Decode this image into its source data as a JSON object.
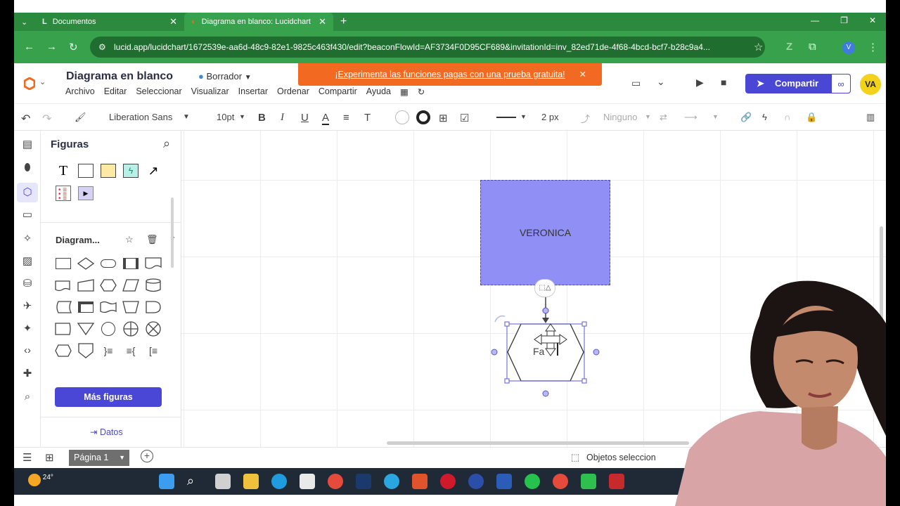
{
  "browser": {
    "tabs": [
      {
        "title": "Documentos",
        "active": false
      },
      {
        "title": "Diagrama en blanco: Lucidchart",
        "active": true
      }
    ],
    "url": "lucid.app/lucidchart/1672539e-aa6d-48c9-82e1-9825c463f430/edit?beaconFlowId=AF3734F0D95CF689&invitationId=inv_82ed71de-4f68-4bcd-bcf7-b28c9a4...",
    "profile_initial": "V"
  },
  "header": {
    "title": "Diagrama en blanco",
    "status": "Borrador",
    "menus": [
      "Archivo",
      "Editar",
      "Seleccionar",
      "Visualizar",
      "Insertar",
      "Ordenar",
      "Compartir",
      "Ayuda"
    ],
    "promo": "¡Experimenta las funciones pagas con una prueba gratuita!",
    "share_label": "Compartir",
    "avatar_initials": "VA"
  },
  "toolbar": {
    "font": "Liberation Sans",
    "font_size": "10pt",
    "line_width": "2 px",
    "arrow_style": "Ninguno"
  },
  "panel": {
    "title": "Figuras",
    "section": "Diagram...",
    "more_shapes": "Más figuras",
    "data_link": "Datos"
  },
  "canvas": {
    "shape1_text": "VERONICA",
    "shape2_text": "Fa"
  },
  "bottom": {
    "page_label": "Página 1",
    "selection_status": "Objetos seleccion"
  },
  "taskbar": {
    "temperature": "24°"
  },
  "colors": {
    "chrome_green": "#37a24b",
    "accent": "#4a47d6",
    "promo": "#f26a22",
    "shape_fill": "#8f8ff5"
  }
}
